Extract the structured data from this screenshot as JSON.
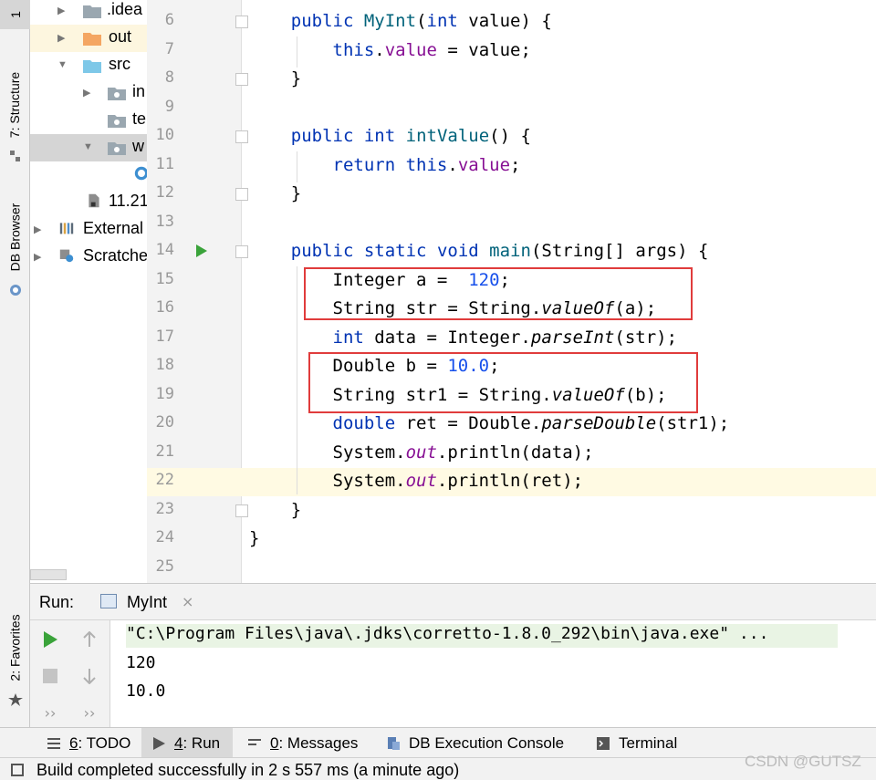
{
  "sidebar": {
    "top_tab": "1",
    "structure_tab": "7: Structure",
    "db_browser_tab": "DB Browser",
    "favorites_tab": "2: Favorites"
  },
  "project_tree": [
    {
      "label": ".idea",
      "type": "folder"
    },
    {
      "label": "out",
      "type": "folder-excluded"
    },
    {
      "label": "src",
      "type": "folder-source"
    },
    {
      "label": "in",
      "type": "package"
    },
    {
      "label": "te",
      "type": "package"
    },
    {
      "label": "w",
      "type": "package"
    },
    {
      "label": "",
      "type": "class"
    },
    {
      "label": "11.21",
      "type": "file"
    },
    {
      "label": "External",
      "type": "libraries"
    },
    {
      "label": "Scratche",
      "type": "scratches"
    }
  ],
  "editor": {
    "line_numbers": [
      "6",
      "7",
      "8",
      "9",
      "10",
      "11",
      "12",
      "13",
      "14",
      "15",
      "16",
      "17",
      "18",
      "19",
      "20",
      "21",
      "22",
      "23",
      "24",
      "25"
    ],
    "code": {
      "l6": [
        "    ",
        "public",
        " ",
        "MyInt",
        "(",
        "int",
        " value) {"
      ],
      "l7": [
        "        ",
        "this",
        ".",
        "value",
        " = value;"
      ],
      "l8": "    }",
      "l10": [
        "    ",
        "public",
        " ",
        "int",
        " ",
        "intValue",
        "() {"
      ],
      "l11": [
        "        ",
        "return",
        " ",
        "this",
        ".",
        "value",
        ";"
      ],
      "l12": "    }",
      "l14": [
        "    ",
        "public",
        " ",
        "static",
        " ",
        "void",
        " ",
        "main",
        "(String[] args) {"
      ],
      "l15": [
        "        Integer a =  ",
        "120",
        ";"
      ],
      "l16": [
        "        String str = String.",
        "valueOf",
        "(a);"
      ],
      "l17": [
        "        ",
        "int",
        " data = Integer.",
        "parseInt",
        "(str);"
      ],
      "l18": [
        "        Double b = ",
        "10.0",
        ";"
      ],
      "l19": [
        "        String str1 = String.",
        "valueOf",
        "(b);"
      ],
      "l20": [
        "        ",
        "double",
        " ret = Double.",
        "parseDouble",
        "(str1);"
      ],
      "l21": [
        "        System.",
        "out",
        ".println(data);"
      ],
      "l22": [
        "        System.",
        "out",
        ".println(ret);"
      ],
      "l23": "    }",
      "l24": "}"
    }
  },
  "run_panel": {
    "label": "Run:",
    "tab_name": "MyInt",
    "tab_close": "×",
    "more_left": "››",
    "more_right": "››",
    "output": [
      "\"C:\\Program Files\\java\\.jdks\\corretto-1.8.0_292\\bin\\java.exe\" ...",
      "120",
      "10.0"
    ]
  },
  "bottom_toolbar": {
    "todo": {
      "mnemonic": "6",
      "rest": ": TODO"
    },
    "run": {
      "mnemonic": "4",
      "rest": ": Run"
    },
    "messages": {
      "mnemonic": "0",
      "rest": ": Messages"
    },
    "db_console": "DB Execution Console",
    "terminal": "Terminal"
  },
  "status_bar": {
    "message": "Build completed successfully in 2 s 557 ms (a minute ago)"
  },
  "watermark": "CSDN @GUTSZ",
  "colors": {
    "keyword": "#0033b3",
    "method": "#00627a",
    "field": "#871094",
    "number": "#1750eb",
    "highlight_box": "#e03c3c",
    "current_line": "#fffae3",
    "run_green": "#3aa33a"
  }
}
